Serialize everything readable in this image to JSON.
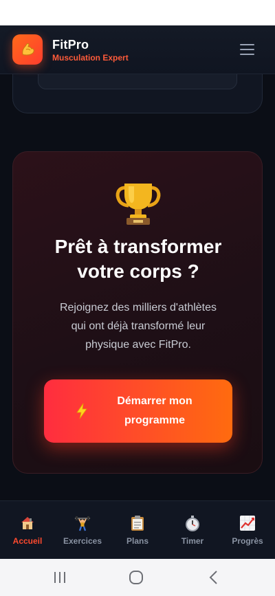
{
  "header": {
    "title": "FitPro",
    "subtitle": "Musculation Expert",
    "logo_icon": "flexed-biceps-icon",
    "menu_icon": "hamburger-menu-icon"
  },
  "cta": {
    "icon": "trophy-icon",
    "title_line1": "Prêt à transformer",
    "title_line2": "votre corps ?",
    "text_line1": "Rejoignez des milliers d'athlètes",
    "text_line2": "qui ont déjà transformé leur",
    "text_line3": "physique avec FitPro.",
    "button_icon": "lightning-icon",
    "button_line1": "Démarrer mon",
    "button_line2": "programme"
  },
  "nav": {
    "items": [
      {
        "label": "Accueil",
        "icon": "house-icon",
        "active": true
      },
      {
        "label": "Exercices",
        "icon": "weightlifter-icon",
        "active": false
      },
      {
        "label": "Plans",
        "icon": "clipboard-icon",
        "active": false
      },
      {
        "label": "Timer",
        "icon": "stopwatch-icon",
        "active": false
      },
      {
        "label": "Progrès",
        "icon": "chart-increasing-icon",
        "active": false
      }
    ]
  },
  "system_nav": {
    "buttons": [
      "recents-icon",
      "home-icon",
      "back-icon"
    ]
  },
  "colors": {
    "accent": "#ff4a2e",
    "accent_orange": "#ff6b0f",
    "background": "#0b0e16",
    "card_background": "#2c1119"
  }
}
